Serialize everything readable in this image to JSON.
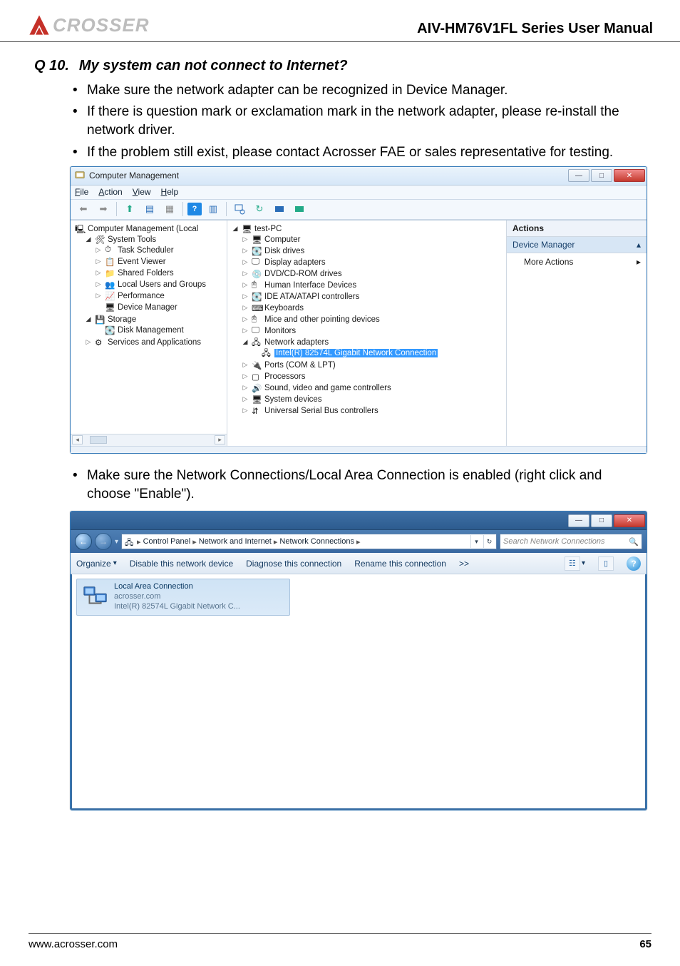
{
  "header": {
    "logo_text": "CROSSER",
    "title": "AIV-HM76V1FL Series User Manual"
  },
  "faq": {
    "q_num": "Q 10.",
    "q_title": "My system can not connect to Internet?",
    "bullets_1": [
      "Make sure the network adapter can be recognized in Device Manager.",
      "If there is question mark or exclamation mark in the network adapter, please re-install the network driver.",
      "If the problem still exist, please contact Acrosser FAE or sales representative for testing."
    ],
    "bullets_2": [
      "Make sure the Network Connections/Local Area Connection is enabled (right click and choose \"Enable\")."
    ]
  },
  "cm": {
    "title": "Computer Management",
    "menu": {
      "file": "File",
      "action": "Action",
      "view": "View",
      "help": "Help"
    },
    "left_tree": {
      "root": "Computer Management (Local",
      "system_tools": "System Tools",
      "task_scheduler": "Task Scheduler",
      "event_viewer": "Event Viewer",
      "shared_folders": "Shared Folders",
      "local_users": "Local Users and Groups",
      "performance": "Performance",
      "device_manager": "Device Manager",
      "storage": "Storage",
      "disk_mgmt": "Disk Management",
      "services": "Services and Applications"
    },
    "mid_tree": {
      "root": "test-PC",
      "computer": "Computer",
      "disk_drives": "Disk drives",
      "display_adapters": "Display adapters",
      "dvd": "DVD/CD-ROM drives",
      "hid": "Human Interface Devices",
      "ide": "IDE ATA/ATAPI controllers",
      "keyboards": "Keyboards",
      "mice": "Mice and other pointing devices",
      "monitors": "Monitors",
      "network_adapters": "Network adapters",
      "intel_nic": "Intel(R) 82574L Gigabit Network Connection",
      "ports": "Ports (COM & LPT)",
      "processors": "Processors",
      "sound": "Sound, video and game controllers",
      "system_devices": "System devices",
      "usb": "Universal Serial Bus controllers"
    },
    "actions": {
      "head": "Actions",
      "sub": "Device Manager",
      "item": "More Actions"
    }
  },
  "nc": {
    "breadcrumb": {
      "control_panel": "Control Panel",
      "net_internet": "Network and Internet",
      "net_conn": "Network Connections"
    },
    "search_placeholder": "Search Network Connections",
    "toolbar": {
      "organize": "Organize",
      "disable": "Disable this network device",
      "diagnose": "Diagnose this connection",
      "rename": "Rename this connection",
      "more": ">>"
    },
    "tile": {
      "l1": "Local Area Connection",
      "l2": "acrosser.com",
      "l3": "Intel(R) 82574L Gigabit Network C..."
    }
  },
  "footer": {
    "url": "www.acrosser.com",
    "page": "65"
  }
}
